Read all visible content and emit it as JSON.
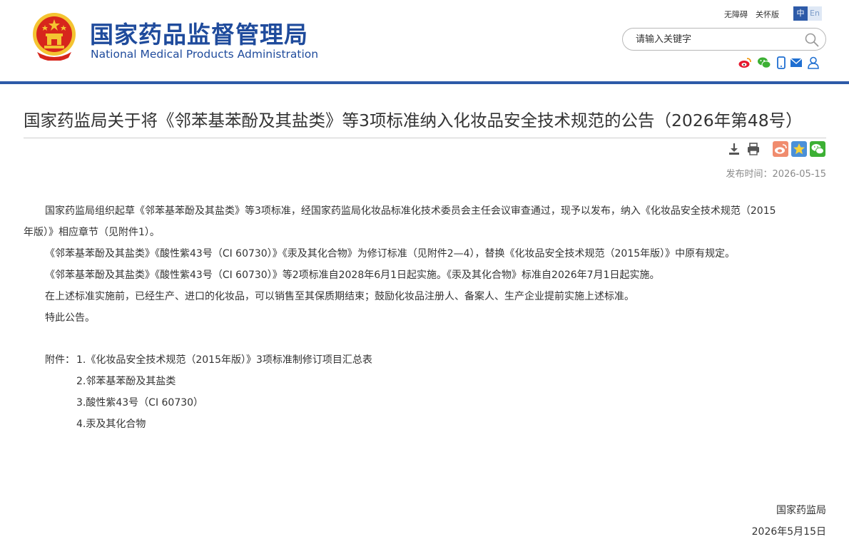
{
  "header": {
    "site_name_cn": "国家药品监督管理局",
    "site_name_en": "National Medical Products Administration",
    "accessibility_link": "无障碍",
    "care_link": "关怀版",
    "lang_zh": "中",
    "lang_en": "En",
    "search_placeholder": "请输入关键字",
    "social_icons": [
      "weibo-icon",
      "wechat-icon",
      "mobile-icon",
      "mail-icon",
      "user-icon"
    ]
  },
  "colors": {
    "brand_blue": "#1f4b9c",
    "header_line": "#2d5aa8",
    "emblem_red": "#d7261c",
    "emblem_gold": "#f4c431"
  },
  "article": {
    "title": "国家药监局关于将《邻苯基苯酚及其盐类》等3项标准纳入化妆品安全技术规范的公告（2026年第48号）",
    "publish_label": "发布时间：2026-05-15",
    "p1_line1": "国家药监局组织起草《邻苯基苯酚及其盐类》等3项标准，经国家药监局化妆品标准化技术委员会主任会议审查通过，现予以发布，纳入《化妆品安全技术规范（2015",
    "p1_line2": "年版）》相应章节（见附件1）。",
    "p2": "《邻苯基苯酚及其盐类》《酸性紫43号（CI 60730）》《汞及其化合物》为修订标准（见附件2—4），替换《化妆品安全技术规范（2015年版）》中原有规定。",
    "p3": "《邻苯基苯酚及其盐类》《酸性紫43号（CI 60730）》等2项标准自2028年6月1日起实施。《汞及其化合物》标准自2026年7月1日起实施。",
    "p4": "在上述标准实施前，已经生产、进口的化妆品，可以销售至其保质期结束；鼓励化妆品注册人、备案人、生产企业提前实施上述标准。",
    "p5": "特此公告。",
    "attachments_label": "附件：",
    "attachments": [
      "1.《化妆品安全技术规范（2015年版）》3项标准制修订项目汇总表",
      "2.邻苯基苯酚及其盐类",
      "3.酸性紫43号（CI 60730）",
      "4.汞及其化合物"
    ],
    "signature_org": "国家药监局",
    "signature_date": "2026年5月15日"
  }
}
